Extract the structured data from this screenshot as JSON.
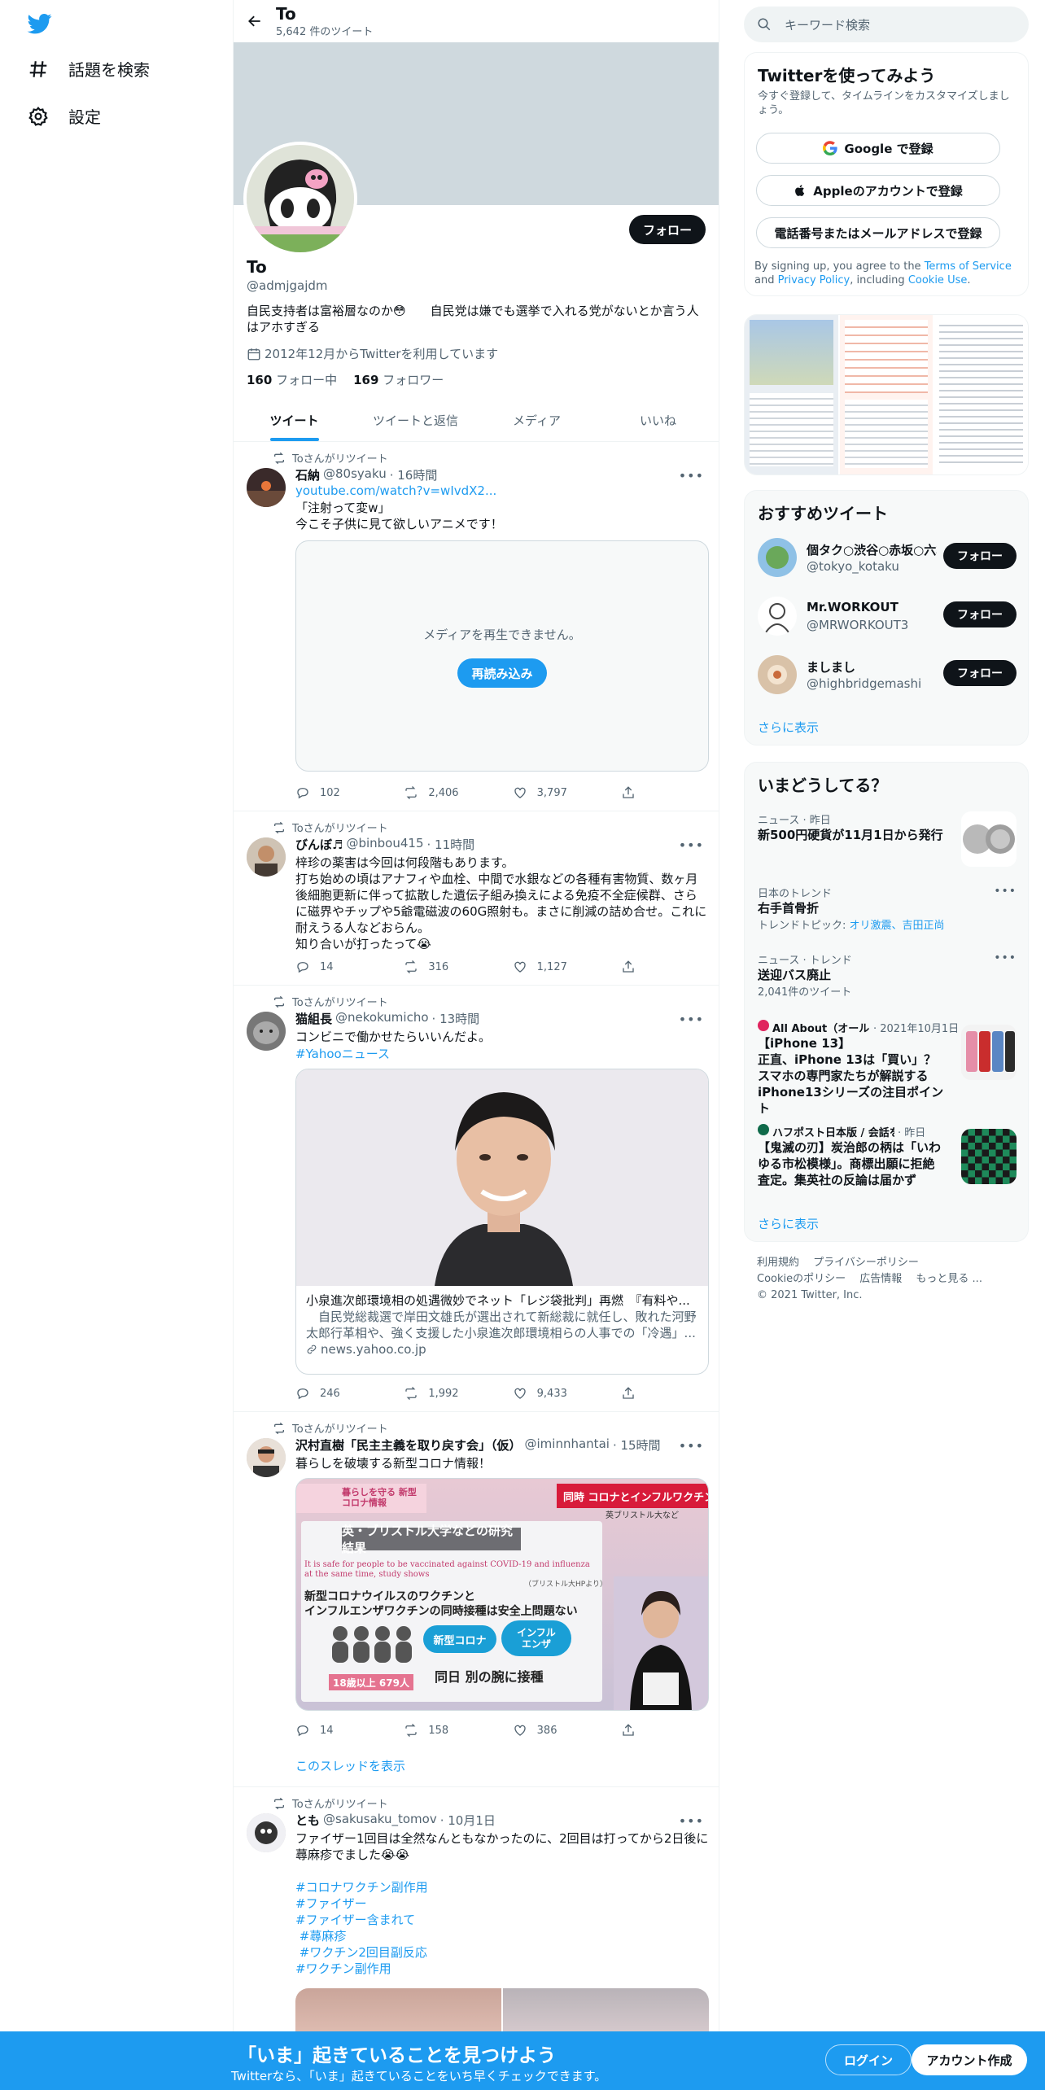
{
  "nav": {
    "items": [
      {
        "label": "話題を検索",
        "icon": "hashtag-icon"
      },
      {
        "label": "設定",
        "icon": "gear-icon"
      }
    ]
  },
  "header": {
    "name": "To",
    "tweet_count": "5,642 件のツイート"
  },
  "profile": {
    "follow_label": "フォロー",
    "name": "To",
    "handle": "@admjgajdm",
    "bio": "自民支持者は富裕層なのか😳　　自民党は嫌でも選挙で入れる党がないとか言う人はアホすぎる",
    "joined": "2012年12月からTwitterを利用しています",
    "following_count": "160",
    "following_label": "フォロー中",
    "followers_count": "169",
    "followers_label": "フォロワー"
  },
  "tabs": [
    "ツイート",
    "ツイートと返信",
    "メディア",
    "いいね"
  ],
  "retweet_label": "Toさんがリツイート",
  "tweets": [
    {
      "name": "石納",
      "handle": "@80syaku",
      "time": "· 16時間",
      "link": "youtube.com/watch?v=wIvdX2...",
      "text": "「注射って変w」\n今こそ子供に見て欲しいアニメです！",
      "media_error": "メディアを再生できません。",
      "reload_label": "再読み込み",
      "replies": "102",
      "retweets": "2,406",
      "likes": "3,797"
    },
    {
      "name": "びんぼ♬",
      "handle": "@binbou415",
      "time": "· 11時間",
      "text": "梓珍の薬害は今回は何段階もあります。\n打ち始めの頃はアナフィや血栓、中間で水銀などの各種有害物質、数ヶ月後細胞更新に伴って拡散した遺伝子組み換えによる免疫不全症候群、さらに磁界やチップや5爺電磁波の60G照射も。まさに削減の詰め合せ。これに耐えうる人などおらん。\n知り合いが打ったって😭",
      "replies": "14",
      "retweets": "316",
      "likes": "1,127"
    },
    {
      "name": "猫組長",
      "handle": "@nekokumicho",
      "time": "· 13時間",
      "text": "コンビニで働かせたらいいんだよ。",
      "hashtag": "#Yahooニュース",
      "card_title": "小泉進次郎環境相の処遇微妙でネット「レジ袋批判」再燃　『有料や...",
      "card_desc": "　自民党総裁選で岸田文雄氏が選出されて新総裁に就任し、敗れた河野太郎行革相や、強く支援した小泉進次郎環境相らの人事での「冷遇」...",
      "card_domain": "news.yahoo.co.jp",
      "replies": "246",
      "retweets": "1,992",
      "likes": "9,433"
    },
    {
      "name": "沢村直樹「民主主義を取り戻す会」（仮）",
      "handle": "@iminnhantai",
      "time": "· 15時間",
      "text": "暮らしを破壊する新型コロナ情報！",
      "img": {
        "corner_left": "暮らしを守る 新型コロナ情報",
        "corner_right": "同時 コロナとインフルワクチン",
        "corner_right_sub": "英ブリストル大など",
        "headline": "英・ブリストル大学などの研究結果",
        "en": "It is safe for people to be vaccinated against COVID-19 and influenza at the same time, study shows",
        "src": "（ブリストル大HPより）",
        "line1": "新型コロナウイルスのワクチンと",
        "line2": "インフルエンザワクチンの同時接種は安全上問題ない",
        "pill1": "新型コロナ",
        "pill2": "インフル エンザ",
        "count": "18歳以上 679人",
        "bottom": "同日 別の腕に接種"
      },
      "replies": "14",
      "retweets": "158",
      "likes": "386",
      "thread_link": "このスレッドを表示"
    },
    {
      "name": "とも",
      "handle": "@sakusaku_tomov",
      "time": "· 10月1日",
      "text": "ファイザー1回目は全然なんともなかったのに、2回目は打ってから2日後に蕁麻疹でました😭😭",
      "hashtags": [
        "#コロナワクチン副作用",
        "#ファイザー",
        "#ファイザー含まれて",
        " #蕁麻疹",
        " #ワクチン2回目副反応",
        "#ワクチン副作用"
      ]
    }
  ],
  "right": {
    "search_placeholder": "キーワード検索",
    "signup_title": "Twitterを使ってみよう",
    "signup_desc": "今すぐ登録して、タイムラインをカスタマイズしましょう。",
    "google_btn": "Google で登録",
    "apple_btn": "Appleのアカウントで登録",
    "phone_btn": "電話番号またはメールアドレスで登録",
    "terms_pre": "By signing up, you agree to the ",
    "terms_link": "Terms of Service",
    "terms_mid": " and ",
    "privacy_link": "Privacy Policy",
    "terms_post": ", including ",
    "cookie_link": "Cookie Use",
    "terms_end": ".",
    "rec_title": "おすすめツイート",
    "recs": [
      {
        "name": "個タク○渋谷○赤坂○六本木",
        "handle": "@tokyo_kotaku",
        "btn": "フォロー"
      },
      {
        "name": "Mr.WORKOUT",
        "handle": "@MRWORKOUT3",
        "btn": "フォロー"
      },
      {
        "name": "ましまし",
        "handle": "@highbridgemashi",
        "btn": "フォロー"
      }
    ],
    "show_more": "さらに表示",
    "trends_title": "いまどうしてる？",
    "trends": [
      {
        "meta": "ニュース · 昨日",
        "title": "新500円硬貨が11月1日から発行"
      },
      {
        "meta": "日本のトレンド",
        "title": "右手首骨折",
        "sub_pre": "トレンドトピック: ",
        "sub_links": "オリ激震、吉田正尚"
      },
      {
        "meta": "ニュース · トレンド",
        "title": "送迎バス廃止",
        "sub": "2,041件のツイート"
      },
      {
        "meta_src": "All About（オール...",
        "meta_time": "· 2021年10月1日",
        "title": "【iPhone 13】\n正直、iPhone 13は「買い」？スマホの専門家たちが解説するiPhone13シリーズの注目ポイント"
      },
      {
        "meta_src": "ハフポスト日本版 / 会話を...",
        "meta_time": "· 昨日",
        "title": "【鬼滅の刃】炭治郎の柄は「いわゆる市松模様」。商標出願に拒絶査定。集英社の反論は届かず"
      }
    ],
    "footer": [
      "利用規約",
      "プライバシーポリシー",
      "Cookieのポリシー",
      "広告情報",
      "もっと見る ...",
      "© 2021 Twitter, Inc."
    ]
  },
  "bottom": {
    "title": "「いま」起きていることを見つけよう",
    "sub": "Twitterなら、「いま」起きていることをいち早くチェックできます。",
    "login": "ログイン",
    "signup": "アカウント作成"
  }
}
